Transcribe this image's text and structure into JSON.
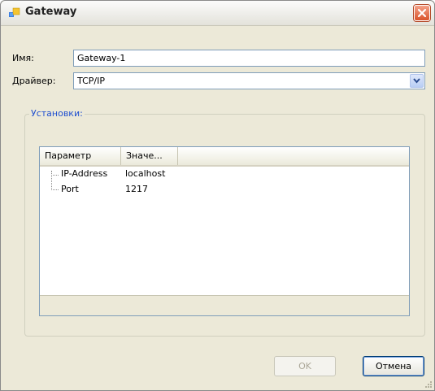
{
  "window": {
    "title": "Gateway"
  },
  "form": {
    "name_label": "Имя:",
    "name_value": "Gateway-1",
    "driver_label": "Драйвер:",
    "driver_value": "TCP/IP"
  },
  "group": {
    "title": "Установки:",
    "columns": [
      "Параметр",
      "Значе..."
    ],
    "rows": [
      {
        "param": "IP-Address",
        "value": "localhost"
      },
      {
        "param": "Port",
        "value": "1217"
      }
    ]
  },
  "buttons": {
    "ok": "OK",
    "cancel": "Отмена"
  },
  "icons": {
    "app": "app-window-icon",
    "close": "close-icon",
    "combo": "chevron-down-icon",
    "grip": "resize-grip-icon"
  },
  "colors": {
    "group_title": "#1f4fd0",
    "close_button": "#d9532a",
    "window_bg": "#ece9d8"
  }
}
